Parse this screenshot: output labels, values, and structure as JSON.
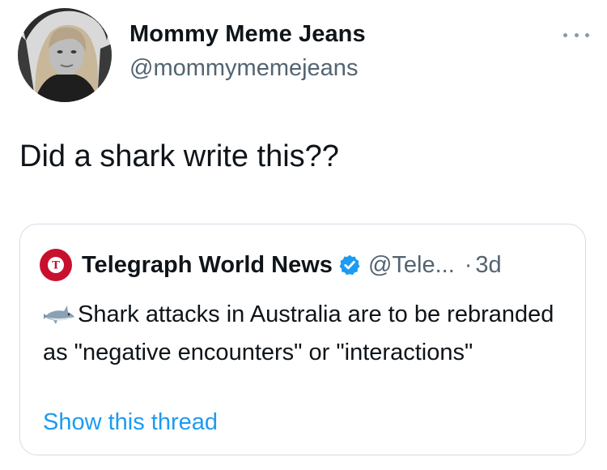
{
  "tweet": {
    "display_name": "Mommy Meme Jeans",
    "handle": "@mommymemejeans",
    "text": "Did a shark write this??",
    "more_icon": "more-horizontal-icon",
    "avatar_icon": "profile-photo"
  },
  "quoted_tweet": {
    "source_logo_icon": "telegraph-logo-icon",
    "display_name": "Telegraph World News",
    "verified_icon": "verified-badge-icon",
    "handle": "@Tele...",
    "separator": "·",
    "time": "3d",
    "leading_icon": "shark-emoji-icon",
    "text": "Shark attacks in Australia are to be rebranded as \"negative encounters\" or \"interactions\"",
    "link_label": "Show this thread"
  },
  "colors": {
    "text": "#0f1419",
    "secondary_text": "#536471",
    "link": "#1d9bf0",
    "verified": "#1d9bf0",
    "card_border": "#d6dde3",
    "telegraph_red": "#c8102e"
  }
}
